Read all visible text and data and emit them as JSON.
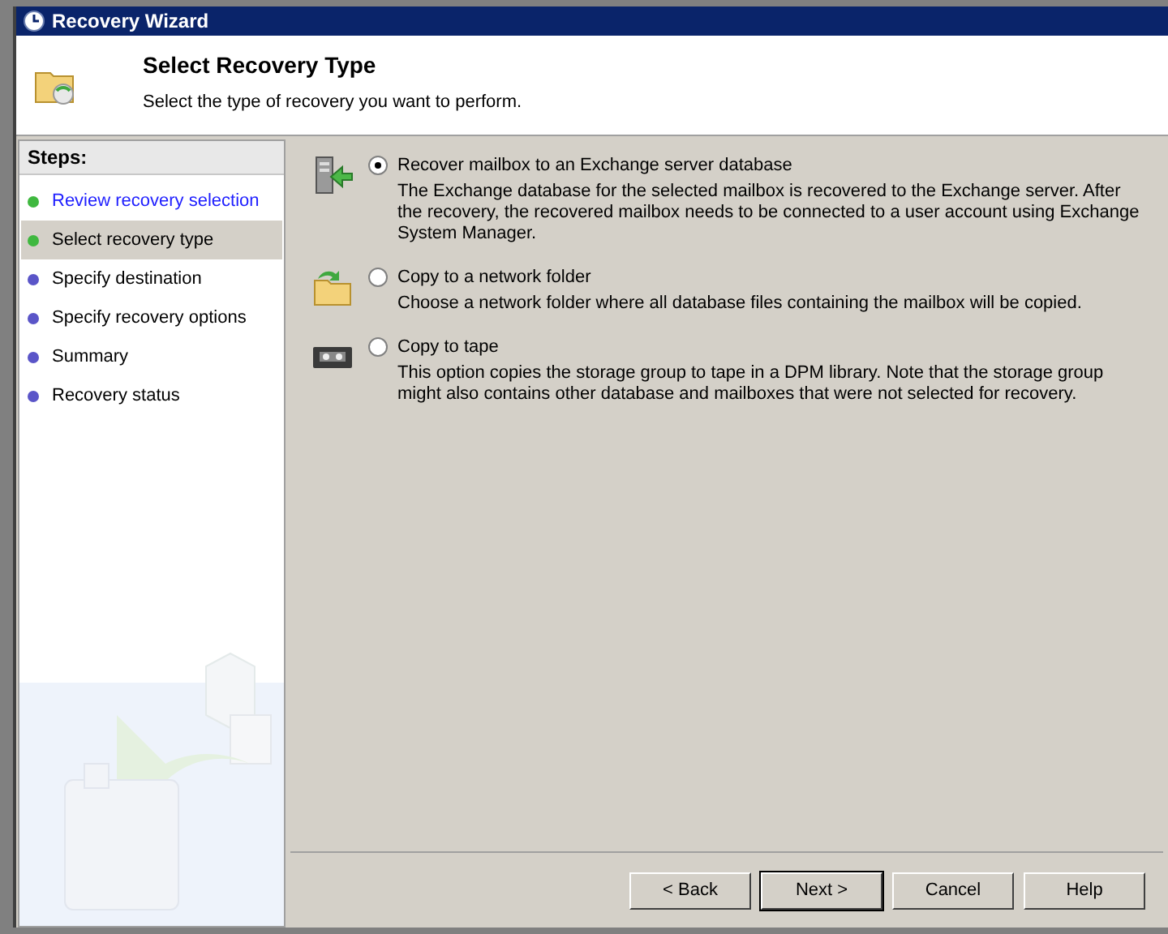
{
  "window": {
    "title": "Recovery Wizard"
  },
  "header": {
    "title": "Select Recovery Type",
    "subtitle": "Select the type of recovery you want to perform."
  },
  "steps": {
    "heading": "Steps:",
    "items": [
      {
        "label": "Review recovery selection",
        "kind": "link",
        "selected": false,
        "color": "#3fb83f"
      },
      {
        "label": "Select recovery type",
        "kind": "plain",
        "selected": true,
        "color": "#3fb83f"
      },
      {
        "label": "Specify destination",
        "kind": "plain",
        "selected": false,
        "color": "#5a55c8"
      },
      {
        "label": "Specify recovery options",
        "kind": "plain",
        "selected": false,
        "color": "#5a55c8"
      },
      {
        "label": "Summary",
        "kind": "plain",
        "selected": false,
        "color": "#5a55c8"
      },
      {
        "label": "Recovery status",
        "kind": "plain",
        "selected": false,
        "color": "#5a55c8"
      }
    ]
  },
  "options": [
    {
      "kind": "server",
      "label": "Recover mailbox to an Exchange server database",
      "selected": true,
      "description": "The Exchange database for the selected mailbox is recovered to the Exchange server.  After the recovery, the recovered mailbox needs to be connected to a user account using Exchange System Manager."
    },
    {
      "kind": "folder",
      "label": "Copy to a network folder",
      "selected": false,
      "description": "Choose a network folder where all database files containing the mailbox will be copied."
    },
    {
      "kind": "tape",
      "label": "Copy to tape",
      "selected": false,
      "description": "This option copies the storage group to tape in a DPM library. Note that the storage group might also contains other database and mailboxes that were not selected for recovery."
    }
  ],
  "buttons": [
    {
      "label": "< Back",
      "kind": "normal"
    },
    {
      "label": "Next >",
      "kind": "default"
    },
    {
      "label": "Cancel",
      "kind": "normal"
    },
    {
      "label": "Help",
      "kind": "normal"
    }
  ]
}
